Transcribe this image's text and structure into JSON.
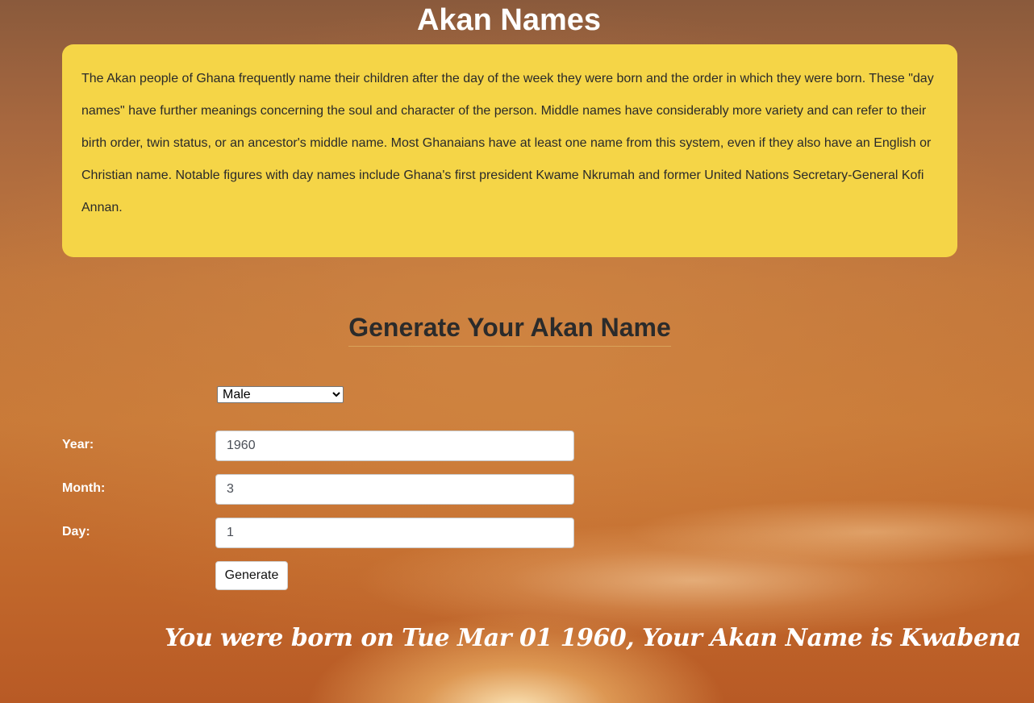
{
  "header": {
    "title": "Akan Names"
  },
  "intro": {
    "text": "The Akan people of Ghana frequently name their children after the day of the week they were born and the order in which they were born. These \"day names\" have further meanings concerning the soul and character of the person. Middle names have considerably more variety and can refer to their birth order, twin status, or an ancestor's middle name. Most Ghanaians have at least one name from this system, even if they also have an English or Christian name. Notable figures with day names include Ghana's first president Kwame Nkrumah and former United Nations Secretary-General Kofi Annan."
  },
  "form": {
    "title": "Generate Your Akan Name",
    "gender": {
      "selected": "Male"
    },
    "year": {
      "label": "Year:",
      "value": "1960"
    },
    "month": {
      "label": "Month:",
      "value": "3"
    },
    "day": {
      "label": "Day:",
      "value": "1"
    },
    "submit_label": "Generate"
  },
  "result": {
    "text": "You were born on Tue Mar 01 1960, Your Akan Name is Kwabena"
  },
  "colors": {
    "card_background": "#f5d547",
    "heading_text": "#ffffff",
    "form_title_text": "#2b2b2b"
  }
}
